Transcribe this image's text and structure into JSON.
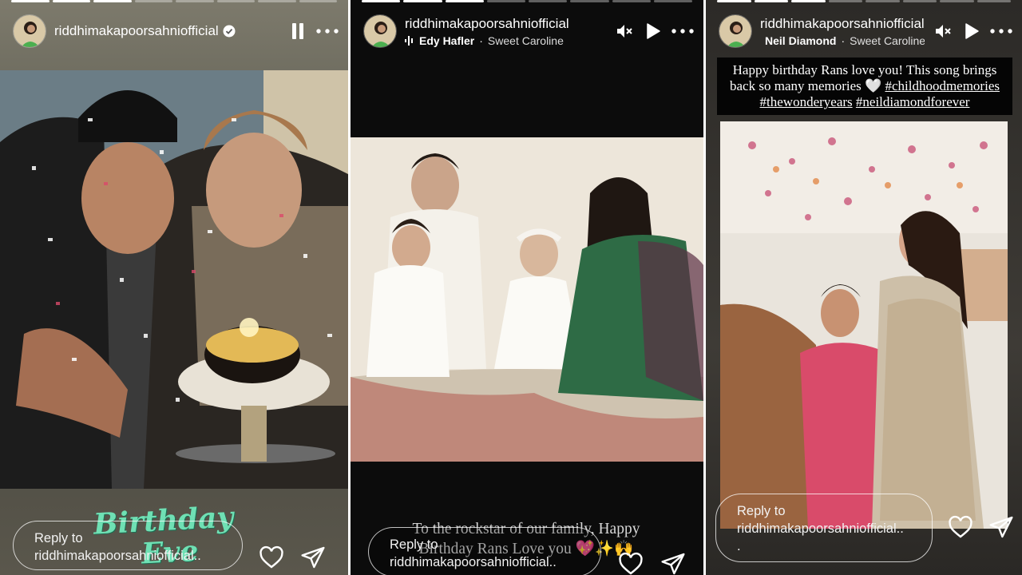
{
  "stories": [
    {
      "username": "riddhimakapoorsahniofficial",
      "verified": true,
      "progress": {
        "segments": 8,
        "completed": 3
      },
      "controls": [
        "pause-icon",
        "more-icon"
      ],
      "sticker": {
        "line1": "Birthday",
        "line2": "Eve"
      },
      "reply": {
        "line1": "Reply to",
        "line2": "riddhimakapoorsahniofficial.."
      },
      "actions": [
        "heart-icon",
        "send-icon"
      ]
    },
    {
      "username": "riddhimakapoorsahniofficial",
      "music": {
        "artist": "Edy Hafler",
        "separator": "·",
        "song": "Sweet Caroline"
      },
      "progress": {
        "segments": 8,
        "completed": 3
      },
      "controls": [
        "mute-icon",
        "play-icon",
        "more-icon"
      ],
      "caption": {
        "line1": "To the rockstar of our family, Happy",
        "line2": "Birthday Rans Love you 💖✨🙌"
      },
      "reply": {
        "line1": "Reply to",
        "line2": "riddhimakapoorsahniofficial.."
      },
      "actions": [
        "heart-icon",
        "send-icon"
      ]
    },
    {
      "username": "riddhimakapoorsahniofficial",
      "music": {
        "artist": "Neil Diamond",
        "separator": "·",
        "song": "Sweet Caroline"
      },
      "progress": {
        "segments": 8,
        "completed": 3
      },
      "controls": [
        "mute-icon",
        "play-icon",
        "more-icon"
      ],
      "caption": {
        "line1": "Happy birthday Rans love you! This song brings",
        "line2_text": "back so many memories 🤍 ",
        "tag1": "#childhoodmemories",
        "tag2": "#thewonderyears",
        "tag3": "#neildiamondforever"
      },
      "reply": {
        "line1": "Reply to",
        "line2": "riddhimakapoorsahniofficial..",
        "line3": "."
      },
      "actions": [
        "heart-icon",
        "send-icon"
      ]
    }
  ],
  "colors": {
    "sticker": "#6fe0b4",
    "background": "#111111"
  }
}
